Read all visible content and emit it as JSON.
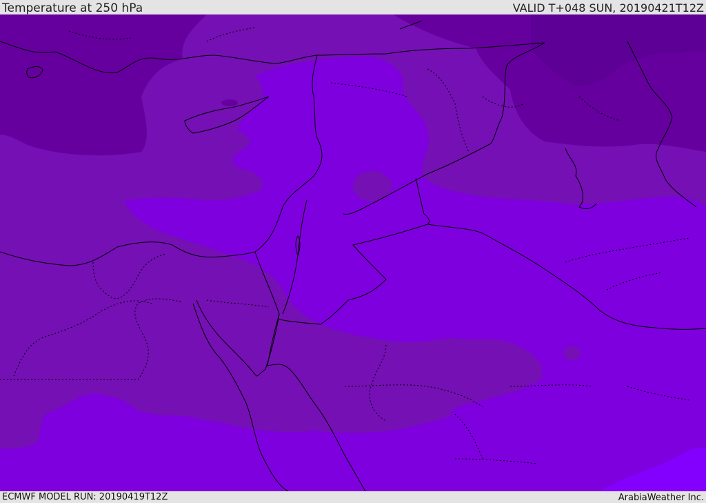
{
  "header": {
    "title": "Temperature at 250 hPa",
    "valid": "VALID T+048 SUN, 20190421T12Z"
  },
  "footer": {
    "model_run": "ECMWF MODEL RUN: 20190419T12Z",
    "credit": "ArabiaWeather Inc."
  },
  "map": {
    "field": "temperature",
    "level": "250 hPa",
    "colors": {
      "darkest": "#5c0096",
      "dark": "#65009f",
      "medium": "#7410b4",
      "bright": "#7f00de",
      "brightest": "#8300ff",
      "border": "#000000"
    }
  }
}
